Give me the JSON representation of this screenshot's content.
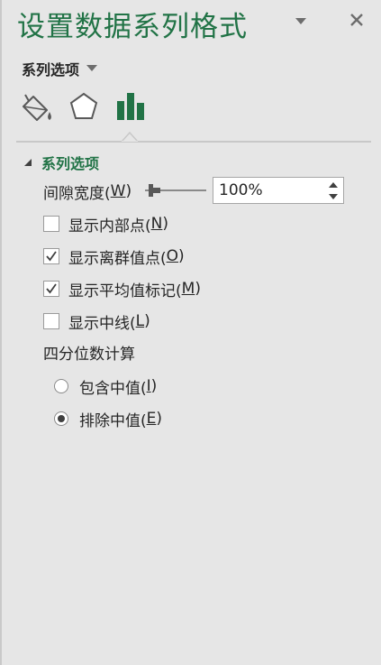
{
  "pane": {
    "title": "设置数据系列格式",
    "section_selector": "系列选项"
  },
  "tabs": [
    {
      "name": "fill-line",
      "icon": "paint-bucket-icon"
    },
    {
      "name": "effects",
      "icon": "pentagon-icon"
    },
    {
      "name": "series-options",
      "icon": "bar-chart-icon",
      "active": true
    }
  ],
  "section": {
    "title": "系列选项",
    "expanded": true
  },
  "gap_width": {
    "label": "间隙宽度(",
    "accel": "W",
    "label_end": ")",
    "value": "100%"
  },
  "checkboxes": [
    {
      "label": "显示内部点(",
      "accel": "N",
      "end": ")",
      "checked": false
    },
    {
      "label": "显示离群值点(",
      "accel": "O",
      "end": ")",
      "checked": true
    },
    {
      "label": "显示平均值标记(",
      "accel": "M",
      "end": ")",
      "checked": true
    },
    {
      "label": "显示中线(",
      "accel": "L",
      "end": ")",
      "checked": false
    }
  ],
  "quartile": {
    "heading": "四分位数计算",
    "options": [
      {
        "label": "包含中值(",
        "accel": "I",
        "end": ")",
        "selected": false
      },
      {
        "label": "排除中值(",
        "accel": "E",
        "end": ")",
        "selected": true
      }
    ]
  },
  "colors": {
    "accent": "#217346",
    "background": "#e6e6e6"
  }
}
